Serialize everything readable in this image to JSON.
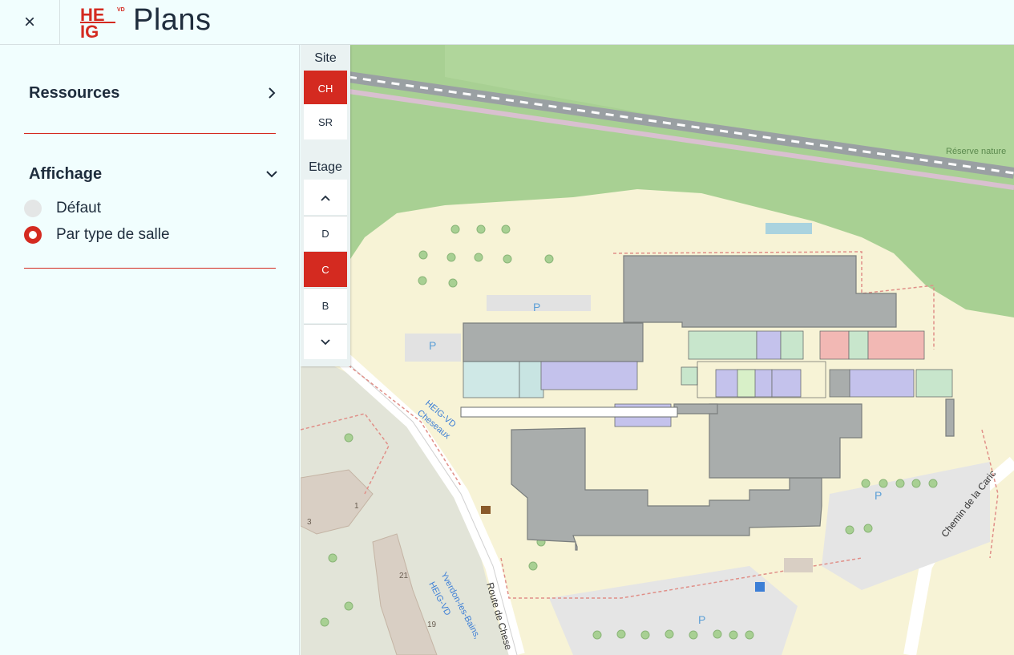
{
  "header": {
    "close_label": "×",
    "logo": {
      "line1": "HE",
      "line2": "IG",
      "superscript": "VD"
    },
    "title": "Plans"
  },
  "sidebar": {
    "ressources": {
      "title": "Ressources",
      "icon": "chevron-right-icon"
    },
    "affichage": {
      "title": "Affichage",
      "icon": "chevron-down-icon",
      "options": [
        {
          "label": "Défaut",
          "selected": false
        },
        {
          "label": "Par type de salle",
          "selected": true
        }
      ]
    }
  },
  "map_controls": {
    "site": {
      "label": "Site",
      "options": [
        "CH",
        "SR"
      ],
      "selected": "CH"
    },
    "etage": {
      "label": "Etage",
      "up_icon": "chevron-up-icon",
      "down_icon": "chevron-down-icon",
      "options": [
        "D",
        "C",
        "B"
      ],
      "selected": "C"
    }
  },
  "map": {
    "labels": {
      "reserve": "Réserve nature",
      "heig_cheseaux": "HEIG-VD Cheseaux",
      "yverdon": "Yverdon-les-Bains, HEIG-VD",
      "route": "Route de Chese",
      "chemin": "Chemin de la Caric",
      "heig_small": "HEIG-VD",
      "num1": "1",
      "num3": "3",
      "num21": "21",
      "num19": "19",
      "parking": "P"
    }
  },
  "colors": {
    "accent": "#d42a20",
    "background": "#f1fefe"
  }
}
